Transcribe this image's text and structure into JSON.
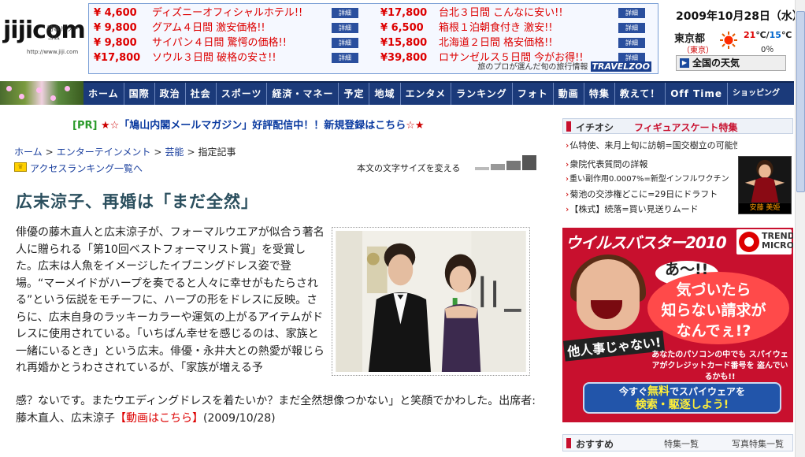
{
  "logo": {
    "text": "jijicom",
    "kana": "時事ドットコム",
    "url": "http://www.jiji.com"
  },
  "travel_ad": {
    "left": [
      {
        "price": "¥ 4,600",
        "name": "ディズニーオフィシャルホテル!!",
        "button": "詳細"
      },
      {
        "price": "¥ 9,800",
        "name": "グアム４日間 激安価格!!",
        "button": "詳細"
      },
      {
        "price": "¥ 9,800",
        "name": "サイパン４日間 驚愕の価格!!",
        "button": "詳細"
      },
      {
        "price": "¥17,800",
        "name": "ソウル３日間 破格の安さ!!",
        "button": "詳細"
      }
    ],
    "right": [
      {
        "price": "¥17,800",
        "name": "台北３日間 こんなに安い!!",
        "button": "詳細"
      },
      {
        "price": "¥ 6,500",
        "name": "箱根１泊朝食付き 激安!!",
        "button": "詳細"
      },
      {
        "price": "¥15,800",
        "name": "北海道２日間 格安価格!!",
        "button": "詳細"
      },
      {
        "price": "¥39,800",
        "name": "ロサンゼルス５日間 今がお得!!",
        "button": "詳細"
      }
    ],
    "footer": "旅のプロが選んだ旬の旅行情報",
    "brand": "TRAVELZOO"
  },
  "weather": {
    "date": "2009年10月28日（水）",
    "city": "東京都",
    "city_sub": "（東京）",
    "hi": "21",
    "lo": "15",
    "unit": "℃/",
    "unit2": "℃",
    "pct": "0％",
    "button": "全国の天気"
  },
  "nav": [
    "ホーム",
    "国際",
    "政治",
    "社会",
    "スポーツ",
    "経済・マネー",
    "予定",
    "地域",
    "エンタメ",
    "ランキング",
    "フォト",
    "動画",
    "特集",
    "教えて！",
    "Off Time",
    "ショッピング"
  ],
  "pr": {
    "tag": "[PR]",
    "stars": "★☆",
    "text": "「鳩山内閣メールマガジン」好評配信中！！新規登録はこちら",
    "stars2": "☆★"
  },
  "breadcrumb": {
    "home": "ホーム",
    "ent": "エンターテインメント",
    "geino": "芸能",
    "current": "指定記事",
    "sep": ">"
  },
  "ranking_link": "アクセスランキング一覧へ",
  "font_size_label": "本文の文字サイズを変える",
  "headline": "広末涼子、再婚は「まだ全然」",
  "body_wrapped": "俳優の藤木直人と広末涼子が、フォーマルウエアが似合う著名人に贈られる「第10回ベストフォーマリスト賞」を受賞した。広末は人魚をイメージしたイブニングドレス姿で登場。“マーメイドがハープを奏でると人々に幸せがもたらされる”という伝説をモチーフに、ハープの形をドレスに反映。さらに、広末自身のラッキーカラーや運気の上がるアイテムがドレスに使用されている。「いちばん幸せを感じるのは、家族と一緒にいるとき」という広末。俳優・永井大との熱愛が報じられ再婚かとうわさされているが、「家族が増える予",
  "body_tail": "感？ないです。またウエディングドレスを着たいか？まだ全然想像つかない」と笑顔でかわした。出席者:藤木直人、広末涼子",
  "video_link": "【動画はこちら】",
  "article_date": "(2009/10/28)",
  "ichioshi": {
    "title": "イチオシ",
    "topic": "フィギュアスケート特集"
  },
  "news": [
    "仏特使、来月上旬に訪朝=国交樹立の可能性探る",
    "衆院代表質問の詳報",
    "重い副作用0.0007%=新型インフルワクチン",
    "菊池の交渉権どこに=29日にドラフト",
    "【株式】続落=買い見送りムード"
  ],
  "thumb_caption": "安藤 美姫",
  "ad": {
    "title": "ウイルスバスター2010",
    "brand": "TREND MICRO",
    "copy0": "あ〜!!",
    "copy1": "気づいたら",
    "copy2": "知らない請求が",
    "copy3": "なんでぇ!?",
    "tagline": "他人事じゃない!",
    "small": "あなたのパソコンの中でも スパイウェアがクレジットカード番号を 盗んでいるかも!!",
    "cta1a": "今すぐ",
    "cta1b": "無料",
    "cta1c": "でスパイウェアを",
    "cta2": "検索・駆逐しよう!"
  },
  "recommend": {
    "title": "おすすめ",
    "link1": "特集一覧",
    "link2": "写真特集一覧"
  }
}
